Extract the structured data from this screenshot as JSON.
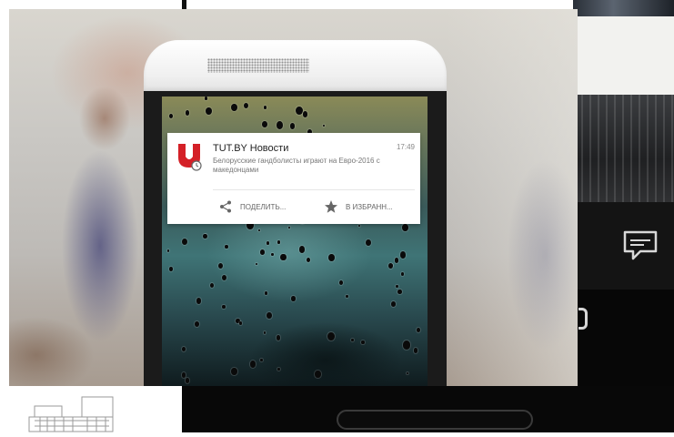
{
  "notification": {
    "app_title": "TUT.BY Новости",
    "time": "17:49",
    "text": "Белорусские гандболисты играют на Евро-2016 с македонцами",
    "actions": [
      {
        "label": "ПОДЕЛИТЬ...",
        "icon": "share-icon"
      },
      {
        "label": "В ИЗБРАНН...",
        "icon": "star-icon"
      }
    ],
    "logo_icon": "tutby-logo-icon",
    "brand_color": "#d42027"
  },
  "background": {
    "chat_icon": "chat-bubble-icon"
  }
}
